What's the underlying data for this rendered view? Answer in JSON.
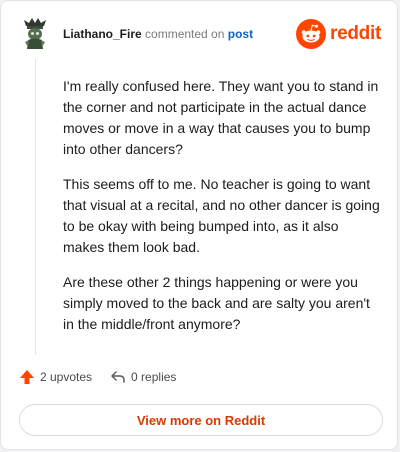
{
  "header": {
    "username": "Liathano_Fire",
    "action_text": "commented on",
    "post_link": "post"
  },
  "brand": {
    "name": "reddit",
    "color": "#ff4500",
    "icon": "reddit-snoo-icon"
  },
  "comment": {
    "paragraphs": [
      "I'm really confused here. They want you to stand in the corner and not participate in the actual dance moves or move in a way that causes you to bump into other dancers?",
      "This seems off to me. No teacher is going to want that visual at a recital, and no other dancer is going to be okay with being bumped into, as it also makes them look bad.",
      "Are these other 2 things happening or were you simply moved to the back and are salty you aren't in the middle/front anymore?"
    ]
  },
  "actions": {
    "upvotes": "2 upvotes",
    "replies": "0 replies",
    "upvote_icon": "upvote-arrow-icon",
    "reply_icon": "reply-arrow-icon",
    "upvote_color": "#ff4500"
  },
  "footer": {
    "view_more": "View more on Reddit"
  }
}
